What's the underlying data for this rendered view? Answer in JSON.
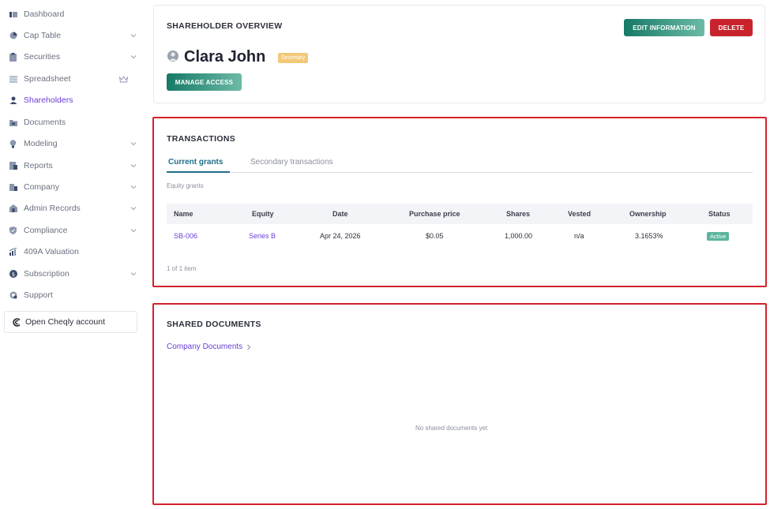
{
  "sidebar": {
    "items": [
      {
        "label": "Dashboard",
        "icon": "dashboard-icon"
      },
      {
        "label": "Cap Table",
        "icon": "pie-chart-icon"
      },
      {
        "label": "Securities",
        "icon": "clipboard-icon"
      },
      {
        "label": "Spreadsheet",
        "icon": "grid-icon"
      },
      {
        "label": "Shareholders",
        "icon": "user-icon"
      },
      {
        "label": "Documents",
        "icon": "folder-icon"
      },
      {
        "label": "Modeling",
        "icon": "lightbulb-icon"
      },
      {
        "label": "Reports",
        "icon": "report-icon"
      },
      {
        "label": "Company",
        "icon": "building-icon"
      },
      {
        "label": "Admin Records",
        "icon": "records-icon"
      },
      {
        "label": "Compliance",
        "icon": "shield-icon"
      },
      {
        "label": "409A Valuation",
        "icon": "valuation-icon"
      },
      {
        "label": "Subscription",
        "icon": "dollar-icon"
      },
      {
        "label": "Support",
        "icon": "support-icon"
      }
    ],
    "cheqly_label": "Open Cheqly account"
  },
  "overview": {
    "title": "SHAREHOLDER OVERVIEW",
    "edit_label": "EDIT INFORMATION",
    "delete_label": "DELETE",
    "name": "Clara John",
    "role_badge": "Secretary",
    "manage_label": "MANAGE ACCESS"
  },
  "transactions": {
    "title": "TRANSACTIONS",
    "tabs": [
      "Current grants",
      "Secondary transactions"
    ],
    "subheading": "Equity grants",
    "columns": [
      "Name",
      "Equity",
      "Date",
      "Purchase price",
      "Shares",
      "Vested",
      "Ownership",
      "Status"
    ],
    "rows": [
      {
        "name": "SB-006",
        "equity": "Series B",
        "date": "Apr 24, 2026",
        "price": "$0.05",
        "shares": "1,000.00",
        "vested": "n/a",
        "ownership": "3.1653%",
        "status": "Active"
      }
    ],
    "pagination": "1 of 1 item"
  },
  "documents": {
    "title": "SHARED DOCUMENTS",
    "link_label": "Company Documents",
    "empty_text": "No shared documents yet"
  },
  "colors": {
    "accent_purple": "#6a3fd6",
    "teal": "#167a66",
    "danger": "#c8232c",
    "highlight_border": "#d3222a",
    "badge_yellow": "#f2c97a",
    "status_green": "#5cb59d"
  }
}
